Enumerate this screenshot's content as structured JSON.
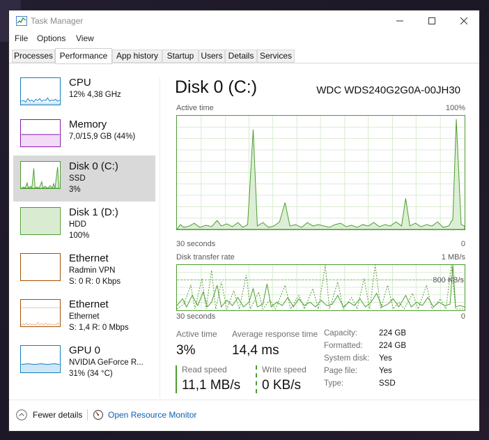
{
  "window": {
    "title": "Task Manager"
  },
  "menu": [
    "File",
    "Options",
    "View"
  ],
  "tabs": [
    {
      "label": "Processes"
    },
    {
      "label": "Performance"
    },
    {
      "label": "App history"
    },
    {
      "label": "Startup"
    },
    {
      "label": "Users"
    },
    {
      "label": "Details"
    },
    {
      "label": "Services"
    }
  ],
  "sidebar": [
    {
      "title": "CPU",
      "line2": "12%  4,38 GHz",
      "line3": ""
    },
    {
      "title": "Memory",
      "line2": "7,0/15,9 GB (44%)",
      "line3": ""
    },
    {
      "title": "Disk 0 (C:)",
      "line2": "SSD",
      "line3": "3%"
    },
    {
      "title": "Disk 1 (D:)",
      "line2": "HDD",
      "line3": "100%"
    },
    {
      "title": "Ethernet",
      "line2": "Radmin VPN",
      "line3": "S: 0 R: 0 Kbps"
    },
    {
      "title": "Ethernet",
      "line2": "Ethernet",
      "line3": "S: 1,4 R: 0 Mbps"
    },
    {
      "title": "GPU 0",
      "line2": "NVIDIA GeForce R...",
      "line3": "31% (34 °C)"
    }
  ],
  "main": {
    "title": "Disk 0 (C:)",
    "model": "WDC WDS240G2G0A-00JH30",
    "graph1": {
      "label": "Active time",
      "max": "100%",
      "time": "30 seconds",
      "min": "0"
    },
    "graph2": {
      "label": "Disk transfer rate",
      "max": "1 MB/s",
      "mid": "800 KB/s",
      "time": "30 seconds",
      "min": "0"
    },
    "stats": {
      "active_time_label": "Active time",
      "active_time_value": "3%",
      "avg_resp_label": "Average response time",
      "avg_resp_value": "14,4 ms",
      "read_label": "Read speed",
      "read_value": "11,1 MB/s",
      "write_label": "Write speed",
      "write_value": "0 KB/s"
    },
    "props": [
      {
        "label": "Capacity:",
        "value": "224 GB"
      },
      {
        "label": "Formatted:",
        "value": "224 GB"
      },
      {
        "label": "System disk:",
        "value": "Yes"
      },
      {
        "label": "Page file:",
        "value": "Yes"
      },
      {
        "label": "Type:",
        "value": "SSD"
      }
    ]
  },
  "footer": {
    "fewer_details": "Fewer details",
    "resource_monitor": "Open Resource Monitor"
  },
  "colors": {
    "disk_green": "#4c9c2e",
    "cpu_blue": "#117dbb",
    "mem_purple": "#8b12ae",
    "eth_orange": "#a74f01",
    "link_blue": "#0d5fb5"
  }
}
